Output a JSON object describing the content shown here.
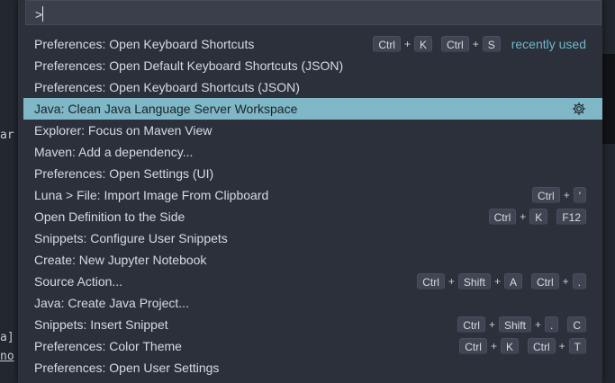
{
  "input": {
    "value": ">",
    "placeholder": ""
  },
  "background": {
    "left_text_1": "ar",
    "left_text_2": "a]",
    "left_text_3": "no"
  },
  "commands": [
    {
      "label": "Preferences: Open Keyboard Shortcuts",
      "keys": [
        [
          "Ctrl",
          "K"
        ],
        [
          "Ctrl",
          "S"
        ]
      ],
      "badge": "recently used"
    },
    {
      "label": "Preferences: Open Default Keyboard Shortcuts (JSON)",
      "keys": []
    },
    {
      "label": "Preferences: Open Keyboard Shortcuts (JSON)",
      "keys": []
    },
    {
      "label": "Java: Clean Java Language Server Workspace",
      "keys": [],
      "selected": true,
      "icon": "gear-icon"
    },
    {
      "label": "Explorer: Focus on Maven View",
      "keys": []
    },
    {
      "label": "Maven: Add a dependency...",
      "keys": []
    },
    {
      "label": "Preferences: Open Settings (UI)",
      "keys": []
    },
    {
      "label": "Luna > File: Import Image From Clipboard",
      "keys": [
        [
          "Ctrl",
          "'"
        ]
      ]
    },
    {
      "label": "Open Definition to the Side",
      "keys": [
        [
          "Ctrl",
          "K"
        ],
        [
          "F12"
        ]
      ]
    },
    {
      "label": "Snippets: Configure User Snippets",
      "keys": []
    },
    {
      "label": "Create: New Jupyter Notebook",
      "keys": []
    },
    {
      "label": "Source Action...",
      "keys": [
        [
          "Ctrl",
          "Shift",
          "A"
        ],
        [
          "Ctrl",
          "."
        ]
      ]
    },
    {
      "label": "Java: Create Java Project...",
      "keys": []
    },
    {
      "label": "Snippets: Insert Snippet",
      "keys": [
        [
          "Ctrl",
          "Shift",
          "."
        ],
        [
          "C"
        ]
      ]
    },
    {
      "label": "Preferences: Color Theme",
      "keys": [
        [
          "Ctrl",
          "K"
        ],
        [
          "Ctrl",
          "T"
        ]
      ]
    },
    {
      "label": "Preferences: Open User Settings",
      "keys": []
    }
  ],
  "colors": {
    "accent": "#7fb7c6",
    "recent_badge": "#6fb8c8",
    "palette_bg": "#2b303b"
  }
}
